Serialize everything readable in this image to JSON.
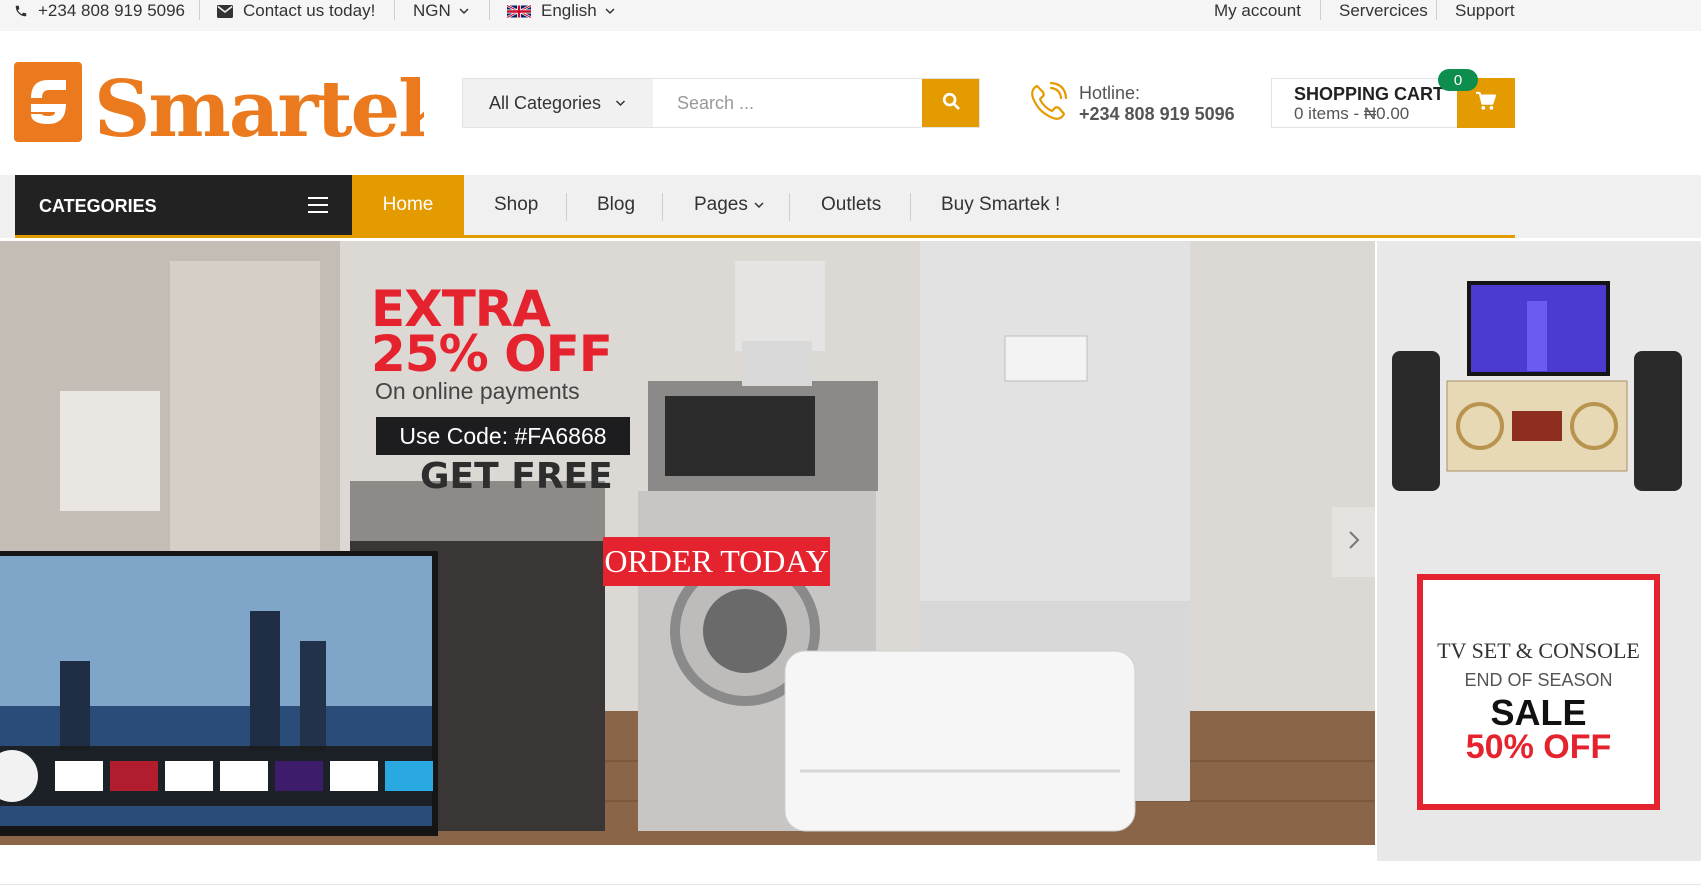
{
  "topbar": {
    "phone": "+234 808 919 5096",
    "contact": "Contact us today!",
    "currency": "NGN",
    "language": "English",
    "links": [
      "My account",
      "Servercices",
      "Support"
    ]
  },
  "brand": {
    "logo_text": "Smartek",
    "logo_color": "#ea7a1d"
  },
  "search": {
    "category": "All Categories",
    "placeholder": "Search ...",
    "button_icon": "search-icon"
  },
  "hotline": {
    "label": "Hotline:",
    "number": "+234 808 919 5096",
    "icon": "phone-icon"
  },
  "cart": {
    "title": "SHOPPING CART",
    "summary": "0 items - ₦0.00",
    "count": "0",
    "icon": "cart-icon"
  },
  "nav": {
    "categories_label": "CATEGORIES",
    "items": [
      "Home",
      "Shop",
      "Blog",
      "Pages",
      "Outlets",
      "Buy Smartek !"
    ],
    "active": "Home"
  },
  "hero": {
    "line1": "EXTRA",
    "line2": "25% OFF",
    "subline": "On online payments",
    "code": "Use Code: #FA6868",
    "get_free": "GET FREE",
    "cta": "ORDER TODAY"
  },
  "side_banner": {
    "line1": "TV SET & CONSOLE",
    "line2": "END OF SEASON",
    "line3": "SALE",
    "line4": "50% OFF"
  },
  "colors": {
    "accent": "#e39b00",
    "dark": "#222222",
    "sale_red": "#e5232e",
    "badge_green": "#0e8e4e"
  }
}
